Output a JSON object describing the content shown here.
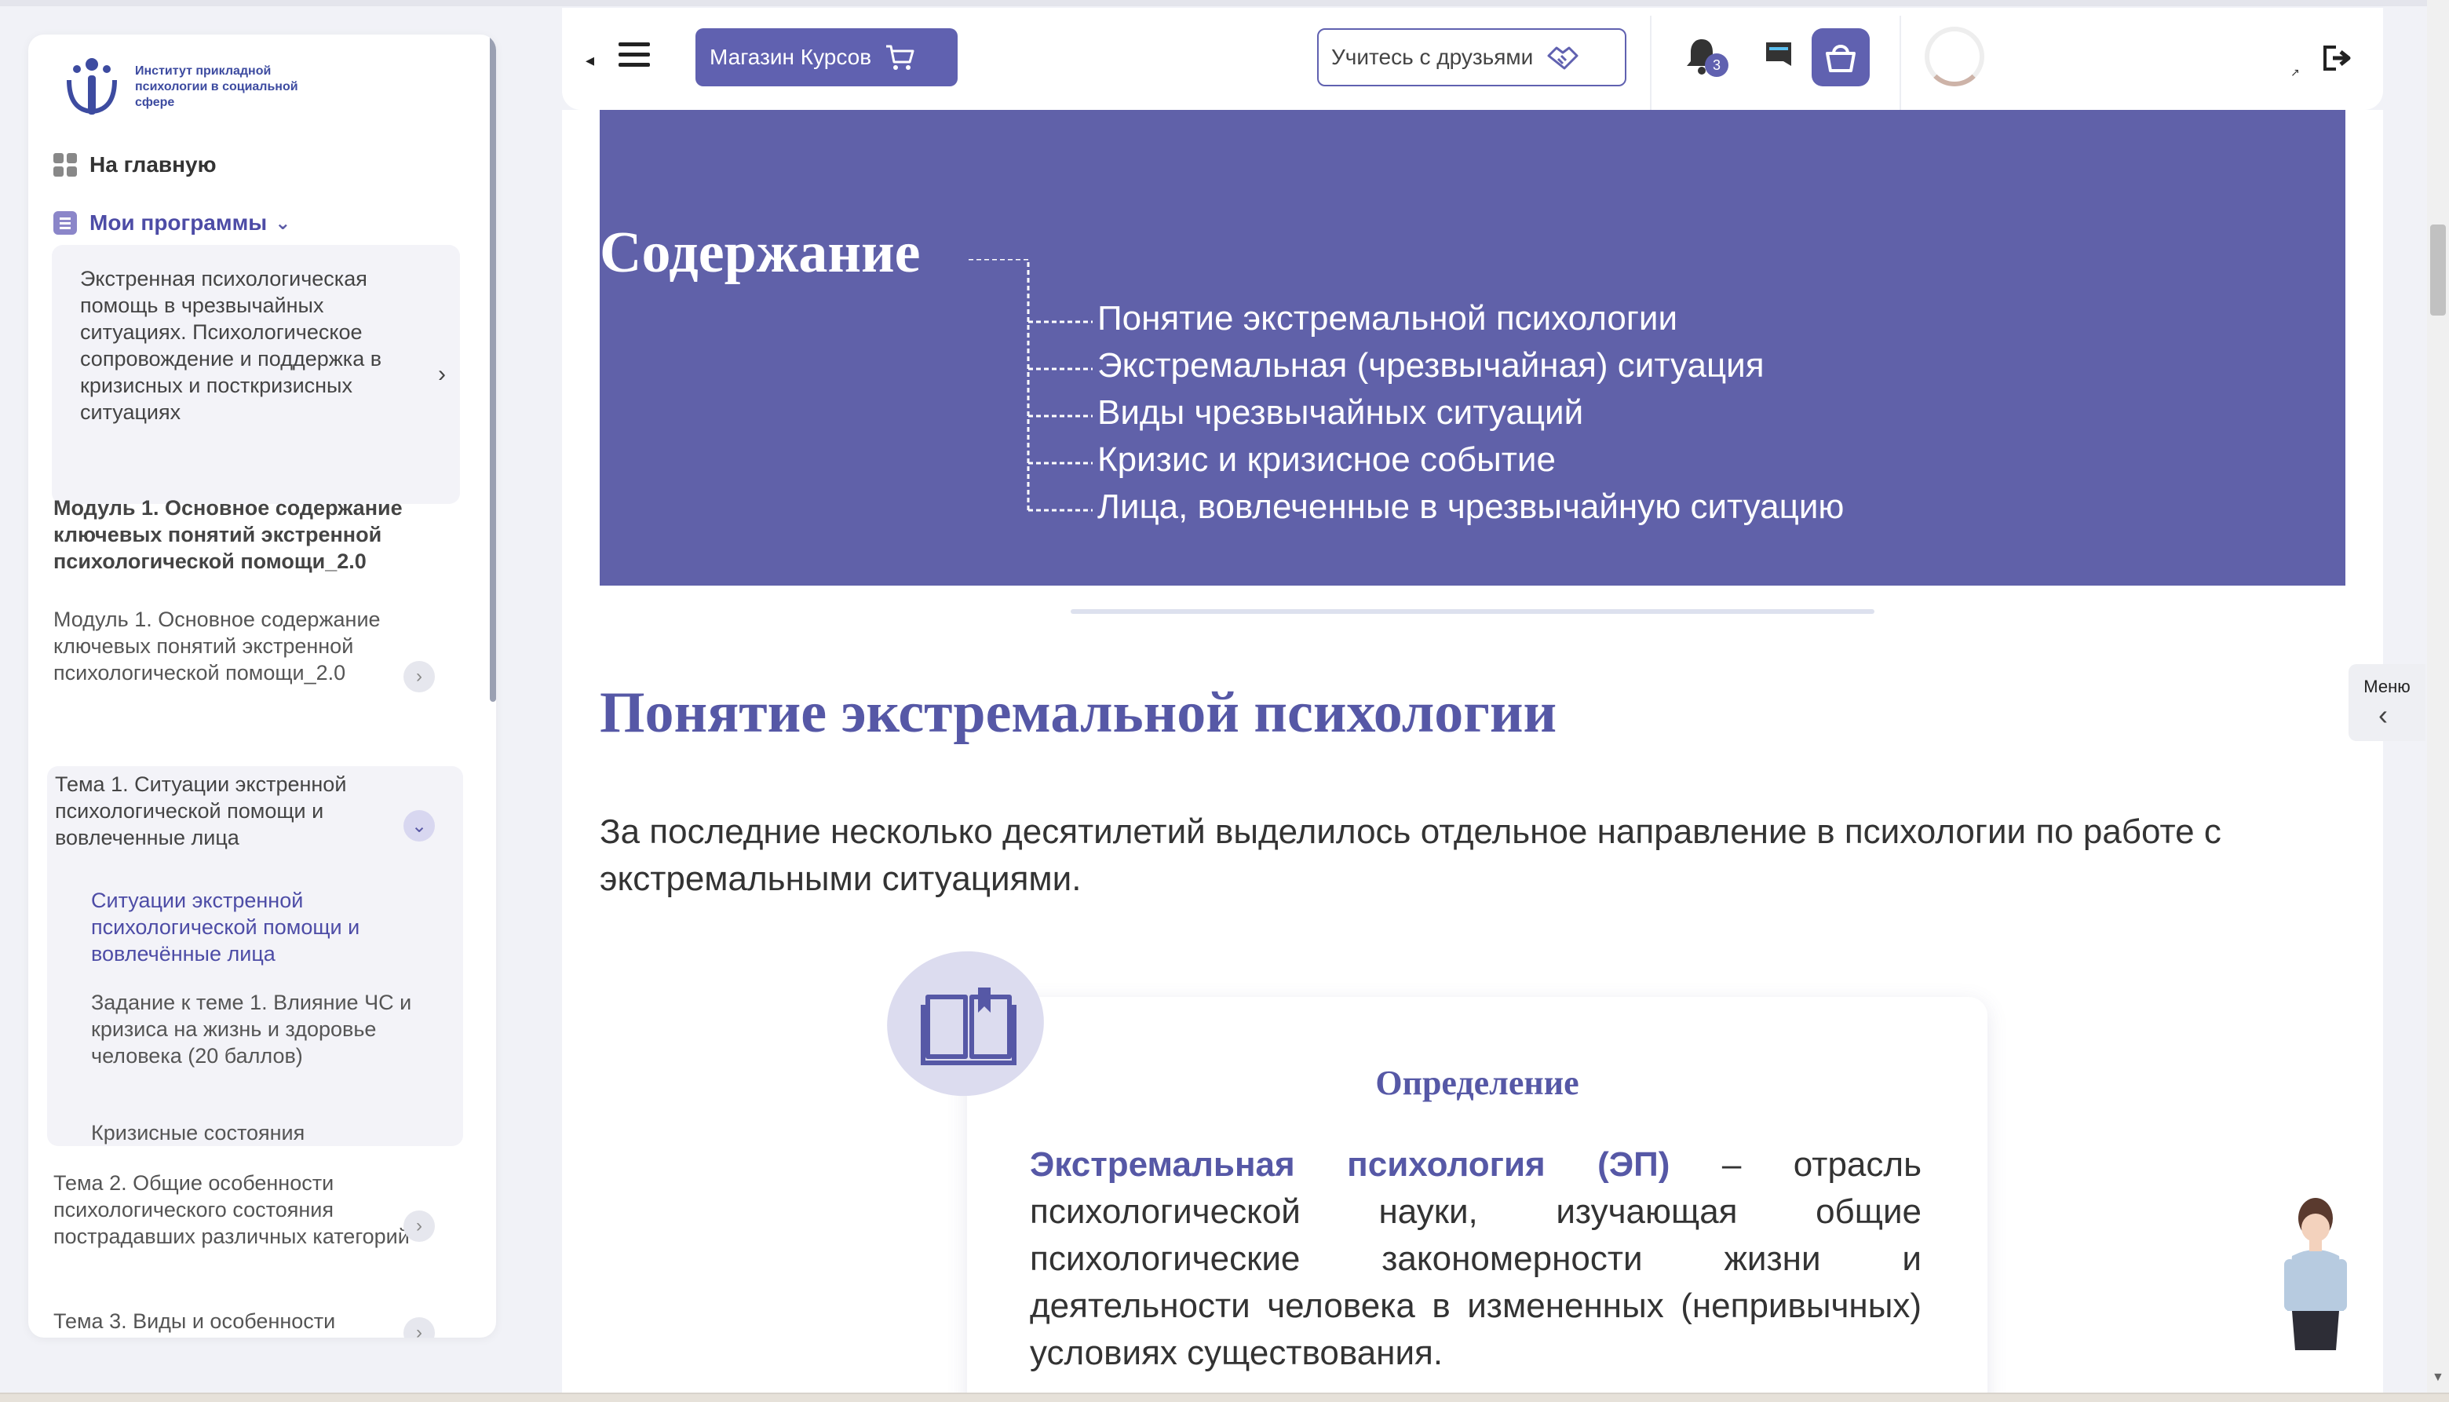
{
  "brand": {
    "logo_text": "Институт прикладной психологии в социальной сфере"
  },
  "sidebar": {
    "home_label": "На главную",
    "programs_label": "Мои программы",
    "course_title": "Экстренная психологическая помощь в чрезвычайных ситуациях. Психологическое сопровождение и поддержка в кризисных и посткризисных ситуациях",
    "module_heading": "Модуль 1. Основное содержание ключевых понятий экстренной психологической помощи_2.0",
    "module_item": "Модуль 1. Основное содержание ключевых понятий экстренной психологической помощи_2.0",
    "topic1": "Тема 1. Ситуации экстренной психологической помощи и вовлеченные лица",
    "topic1_items": [
      "Ситуации экстренной психологической помощи и вовлечённые лица",
      "Задание к теме 1. Влияние ЧС и кризиса на жизнь и здоровье человека (20 баллов)",
      "Кризисные состояния"
    ],
    "topic2": "Тема 2. Общие особенности психологического состояния пострадавших различных категорий",
    "topic3": "Тема 3. Виды и особенности"
  },
  "header": {
    "shop_label": "Магазин Курсов",
    "friends_label": "Учитесь с друзьями",
    "notifications_count": "3"
  },
  "main": {
    "toc_title": "Содержание",
    "toc_items": [
      "Понятие экстремальной психологии",
      "Экстремальная (чрезвычайная) ситуация",
      "Виды чрезвычайных ситуаций",
      "Кризис и кризисное событие",
      "Лица, вовлеченные в чрезвычайную ситуацию"
    ],
    "section_title": "Понятие экстремальной психологии",
    "intro": "За последние несколько десятилетий выделилось отдельное направление в психологии по работе с экстремальными ситуациями.",
    "definition": {
      "heading": "Определение",
      "term": "Экстремальная психология (ЭП)",
      "text": " – отрасль психологической науки, изучающая общие психологические закономерности жизни и деятельности человека в измененных (непривычных) условиях существования."
    }
  },
  "side_menu": {
    "label": "Меню"
  },
  "colors": {
    "accent": "#6061b0",
    "banner": "#6061a9",
    "heading": "#5658a6"
  }
}
